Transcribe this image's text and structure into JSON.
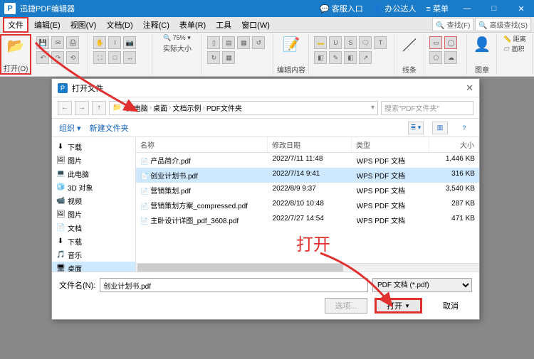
{
  "app": {
    "title": "迅捷PDF编辑器"
  },
  "titlebar_right": {
    "chat": "客服入口",
    "user": "办公达人",
    "menu": "菜单"
  },
  "menu": {
    "file": "文件",
    "edit": "编辑(E)",
    "view": "视图(V)",
    "doc": "文档(D)",
    "comment": "注释(C)",
    "form": "表单(R)",
    "tool": "工具",
    "window": "窗口(W)",
    "find": "查找(F)",
    "advfind": "高级查找(S)"
  },
  "ribbon": {
    "open": "打开(O)",
    "zoom_value": "75%",
    "zoom_lbl": "实际大小",
    "editcontent": "编辑内容",
    "line": "线条",
    "image": "图章",
    "dist": "距离",
    "area": "面积"
  },
  "dialog": {
    "title": "打开文件",
    "crumb": [
      "此电脑",
      "桌面",
      "文档示例",
      "PDF文件夹"
    ],
    "search_placeholder": "搜索\"PDF文件夹\"",
    "organize": "组织",
    "newfolder": "新建文件夹",
    "cols": {
      "name": "名称",
      "date": "修改日期",
      "type": "类型",
      "size": "大小"
    },
    "sidebar": [
      {
        "icon": "⬇",
        "label": "下载"
      },
      {
        "icon": "🖼",
        "label": "图片"
      },
      {
        "icon": "💻",
        "label": "此电脑",
        "head": true
      },
      {
        "icon": "🧊",
        "label": "3D 对象"
      },
      {
        "icon": "📹",
        "label": "视频"
      },
      {
        "icon": "🖼",
        "label": "图片"
      },
      {
        "icon": "📄",
        "label": "文档"
      },
      {
        "icon": "⬇",
        "label": "下载"
      },
      {
        "icon": "🎵",
        "label": "音乐"
      },
      {
        "icon": "🖥",
        "label": "桌面",
        "sel": true
      }
    ],
    "files": [
      {
        "name": "产品简介.pdf",
        "date": "2022/7/11 11:48",
        "type": "WPS PDF 文档",
        "size": "1,446 KB"
      },
      {
        "name": "创业计划书.pdf",
        "date": "2022/7/14 9:41",
        "type": "WPS PDF 文档",
        "size": "316 KB",
        "selected": true
      },
      {
        "name": "营销策划.pdf",
        "date": "2022/8/9 9:37",
        "type": "WPS PDF 文档",
        "size": "3,540 KB"
      },
      {
        "name": "营销策划方案_compressed.pdf",
        "date": "2022/8/10 10:48",
        "type": "WPS PDF 文档",
        "size": "287 KB"
      },
      {
        "name": "主卧设计详图_pdf_3608.pdf",
        "date": "2022/7/27 14:54",
        "type": "WPS PDF 文档",
        "size": "471 KB"
      }
    ],
    "filename_lbl": "文件名(N):",
    "filename_val": "创业计划书.pdf",
    "filter": "PDF 文档 (*.pdf)",
    "options": "选项...",
    "open": "打开",
    "cancel": "取消"
  },
  "annot": {
    "open_label": "打开"
  }
}
